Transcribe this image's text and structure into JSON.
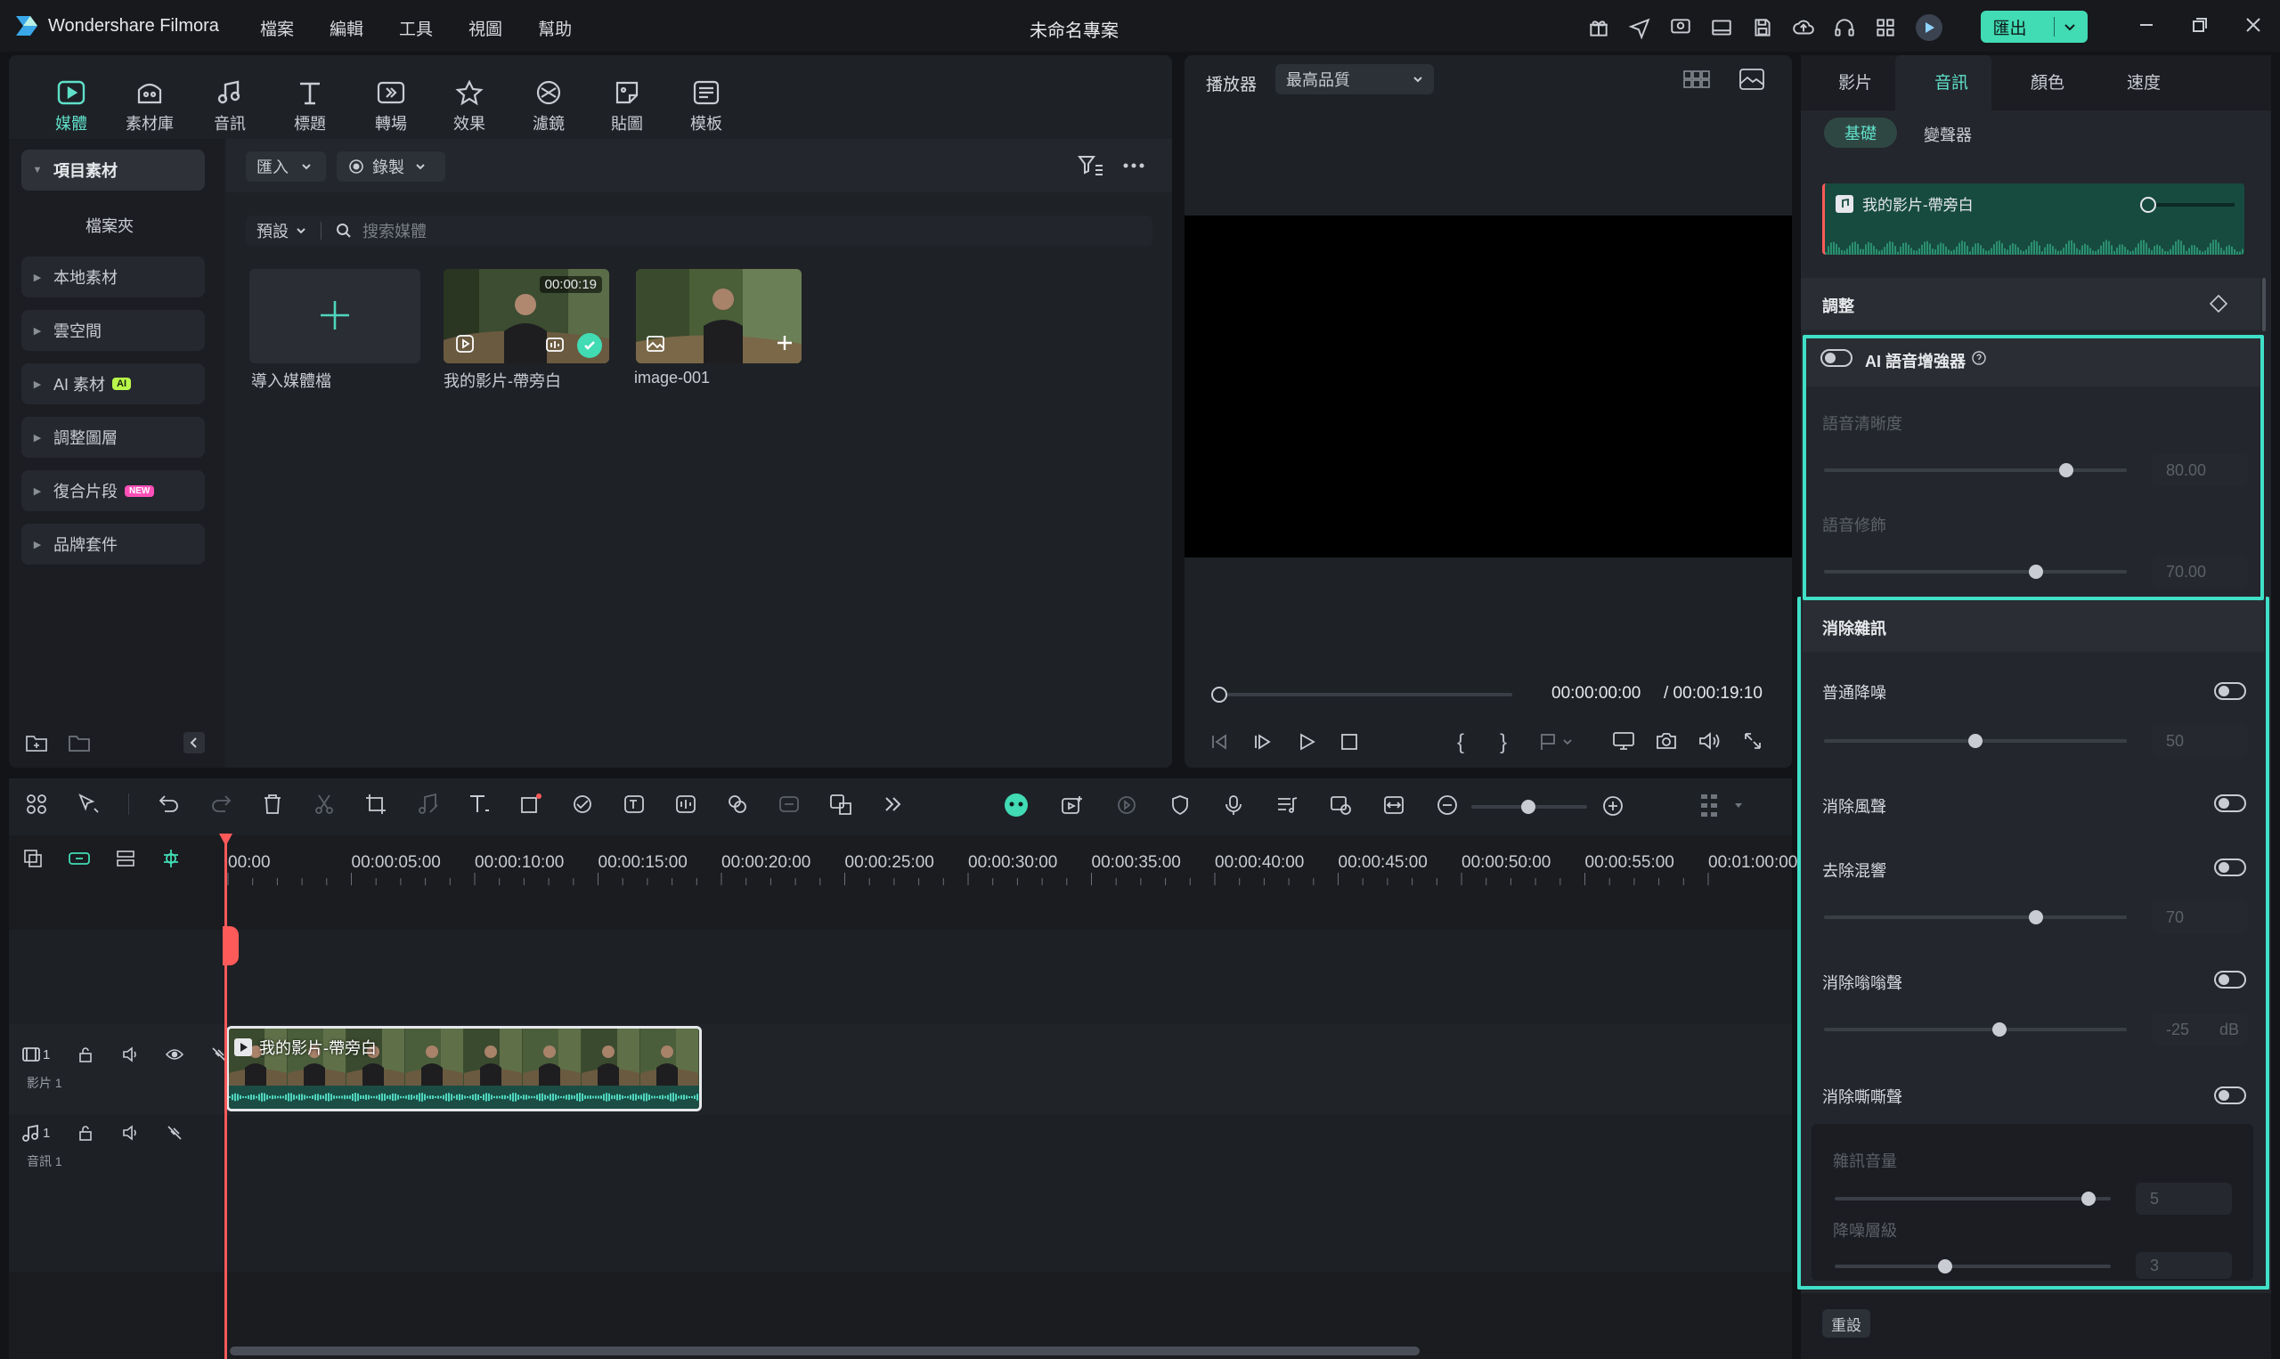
{
  "app": {
    "name": "Wondershare Filmora",
    "project_title": "未命名專案",
    "export_label": "匯出"
  },
  "menu": [
    "檔案",
    "編輯",
    "工具",
    "視圖",
    "幫助"
  ],
  "toolbar": [
    {
      "label": "媒體",
      "icon": "media-icon",
      "active": true
    },
    {
      "label": "素材庫",
      "icon": "stock-icon"
    },
    {
      "label": "音訊",
      "icon": "audio-icon"
    },
    {
      "label": "標題",
      "icon": "title-icon"
    },
    {
      "label": "轉場",
      "icon": "transition-icon"
    },
    {
      "label": "效果",
      "icon": "effects-icon"
    },
    {
      "label": "濾鏡",
      "icon": "filter-icon"
    },
    {
      "label": "貼圖",
      "icon": "sticker-icon"
    },
    {
      "label": "模板",
      "icon": "template-icon"
    }
  ],
  "sidebar": {
    "project_media": "項目素材",
    "folder": "檔案夾",
    "items": [
      {
        "label": "本地素材"
      },
      {
        "label": "雲空間"
      },
      {
        "label": "AI 素材",
        "badge": "AI"
      },
      {
        "label": "調整圖層"
      },
      {
        "label": "復合片段",
        "badge": "NEW"
      },
      {
        "label": "品牌套件"
      }
    ]
  },
  "media": {
    "import_label": "匯入",
    "record_label": "錄製",
    "preset_label": "預設",
    "search_placeholder": "搜索媒體",
    "items": [
      {
        "label": "導入媒體檔"
      },
      {
        "label": "我的影片-帶旁白",
        "duration": "00:00:19"
      },
      {
        "label": "image-001"
      }
    ]
  },
  "player": {
    "label": "播放器",
    "quality": "最高品質",
    "current_time": "00:00:00:00",
    "total_time": "/ 00:00:19:10",
    "progress": 0
  },
  "timeline": {
    "ruler": [
      "00:00",
      "00:00:05:00",
      "00:00:10:00",
      "00:00:15:00",
      "00:00:20:00",
      "00:00:25:00",
      "00:00:30:00",
      "00:00:35:00",
      "00:00:40:00",
      "00:00:45:00",
      "00:00:50:00",
      "00:00:55:00",
      "00:01:00:00"
    ],
    "video_track": {
      "index": "1",
      "name": "影片 1"
    },
    "audio_track": {
      "index": "1",
      "name": "音訊 1"
    },
    "clip_label": "我的影片-帶旁白"
  },
  "right_panel": {
    "tabs": [
      "影片",
      "音訊",
      "顏色",
      "速度"
    ],
    "active_tab": "音訊",
    "subtabs": [
      "基礎",
      "變聲器"
    ],
    "clip_name": "我的影片-帶旁白",
    "adjust_title": "調整",
    "ai_enhancer": {
      "label": "AI 語音增強器",
      "clarity_label": "語音清晰度",
      "clarity_value": "80.00",
      "clarity": 0.8,
      "beautify_label": "語音修飾",
      "beautify_value": "70.00",
      "beautify": 0.7
    },
    "denoise": {
      "title": "消除雜訊",
      "normal_label": "普通降噪",
      "normal_value": "50",
      "normal": 0.5,
      "wind_label": "消除風聲",
      "reverb_label": "去除混響",
      "reverb_value": "70",
      "reverb": 0.7,
      "hum_label": "消除嗡嗡聲",
      "hum_value": "-25",
      "hum_unit": "dB",
      "hum": 0.58,
      "hiss_label": "消除嘶嘶聲",
      "noise_volume_label": "雜訊音量",
      "noise_volume_value": "5",
      "noise_volume": 0.92,
      "denoise_level_label": "降噪層級",
      "denoise_level_value": "3",
      "denoise_level": 0.4
    },
    "reset_label": "重設"
  },
  "colors": {
    "accent": "#4fd6be",
    "highlight_border": "#3fe0c7",
    "playhead": "#ff5a5a",
    "export": "#41dbb4"
  }
}
